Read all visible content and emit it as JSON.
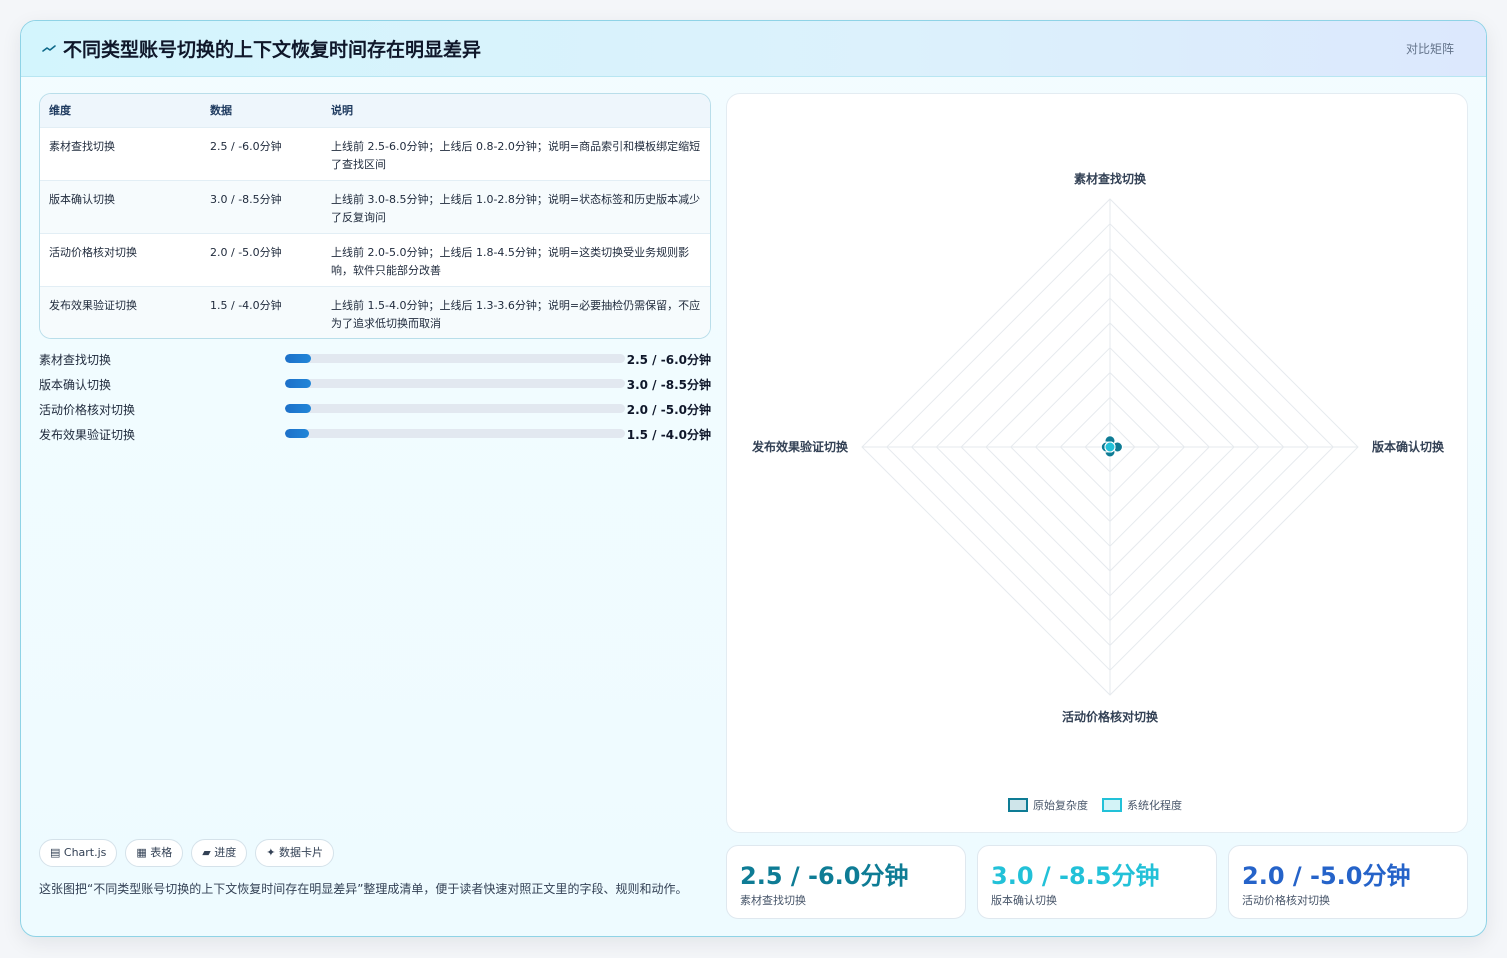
{
  "header": {
    "title": "不同类型账号切换的上下文恢复时间存在明显差异",
    "tag": "对比矩阵"
  },
  "table": {
    "headers": [
      "维度",
      "数据",
      "说明"
    ],
    "rows": [
      [
        "素材查找切换",
        "2.5 / -6.0分钟",
        "上线前 2.5-6.0分钟；上线后 0.8-2.0分钟；说明=商品索引和模板绑定缩短了查找区间"
      ],
      [
        "版本确认切换",
        "3.0 / -8.5分钟",
        "上线前 3.0-8.5分钟；上线后 1.0-2.8分钟；说明=状态标签和历史版本减少了反复询问"
      ],
      [
        "活动价格核对切换",
        "2.0 / -5.0分钟",
        "上线前 2.0-5.0分钟；上线后 1.8-4.5分钟；说明=这类切换受业务规则影响，软件只能部分改善"
      ],
      [
        "发布效果验证切换",
        "1.5 / -4.0分钟",
        "上线前 1.5-4.0分钟；上线后 1.3-3.6分钟；说明=必要抽检仍需保留，不应为了追求低切换而取消"
      ]
    ]
  },
  "progress": [
    {
      "label": "素材查找切换",
      "value": "2.5 / -6.0分钟",
      "fill": 0.075
    },
    {
      "label": "版本确认切换",
      "value": "3.0 / -8.5分钟",
      "fill": 0.075
    },
    {
      "label": "活动价格核对切换",
      "value": "2.0 / -5.0分钟",
      "fill": 0.075
    },
    {
      "label": "发布效果验证切换",
      "value": "1.5 / -4.0分钟",
      "fill": 0.072
    }
  ],
  "chips": [
    "Chart.js",
    "表格",
    "进度",
    "数据卡片"
  ],
  "chip_icons": [
    "chart-icon",
    "table-icon",
    "progress-icon",
    "sparkle-icon"
  ],
  "note": "这张图把“不同类型账号切换的上下文恢复时间存在明显差异”整理成清单，便于读者快速对照正文里的字段、规则和动作。",
  "stats": [
    {
      "value": "2.5 / -6.0分钟",
      "label": "素材查找切换",
      "color": "#0e7c95"
    },
    {
      "value": "3.0 / -8.5分钟",
      "label": "版本确认切换",
      "color": "#22c1d8"
    },
    {
      "value": "2.0 / -5.0分钟",
      "label": "活动价格核对切换",
      "color": "#2563c9"
    }
  ],
  "chart_data": {
    "type": "radar",
    "axes": [
      "素材查找切换",
      "版本确认切换",
      "活动价格核对切换",
      "发布效果验证切换"
    ],
    "series": [
      {
        "name": "原始复杂度",
        "values": [
          2.5,
          3.0,
          2.0,
          1.5
        ],
        "color": "#0e7c95"
      },
      {
        "name": "系统化程度",
        "values": [
          -6.0,
          -8.5,
          -5.0,
          -4.0
        ],
        "color": "#22c1d8"
      }
    ],
    "range": [
      0,
      100
    ],
    "grid": true,
    "legend": "bottom"
  }
}
